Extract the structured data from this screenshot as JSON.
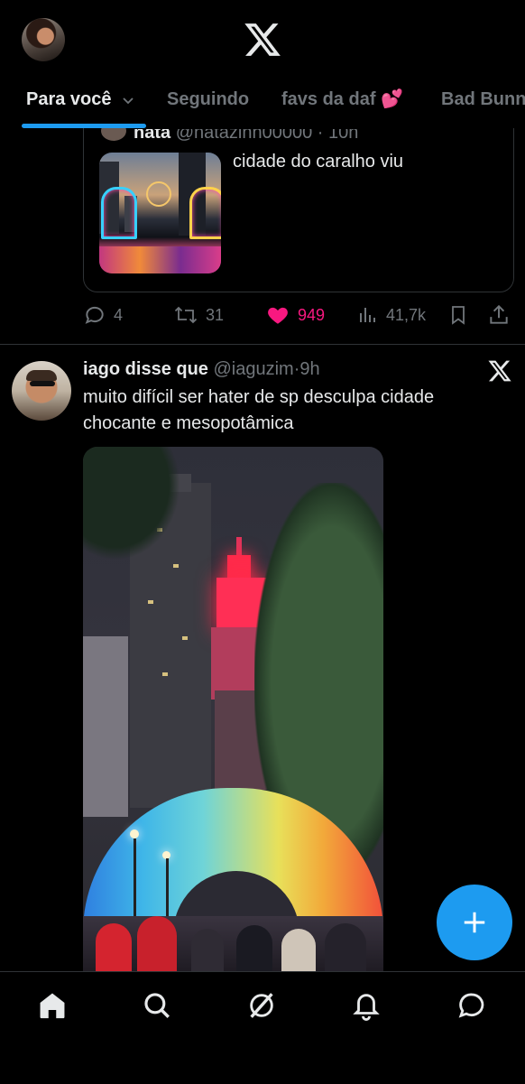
{
  "header": {
    "logo_icon": "x-logo-icon",
    "avatar_icon": "user-avatar"
  },
  "tabs": [
    {
      "label": "Para você",
      "active": true,
      "has_chevron": true
    },
    {
      "label": "Seguindo",
      "active": false
    },
    {
      "label": "favs da daf 💕",
      "active": false
    },
    {
      "label": "Bad Bunn",
      "active": false
    }
  ],
  "tweet1": {
    "quote": {
      "name": "nata",
      "handle": "@natazinh00000",
      "time": "· 10h",
      "text": "cidade do caralho viu"
    },
    "actions": {
      "replies": "4",
      "retweets": "31",
      "likes": "949",
      "views": "41,7k",
      "liked": true
    }
  },
  "tweet2": {
    "name": "iago disse que",
    "handle": "@iaguzim",
    "dot": "·",
    "time": "9h",
    "text": "muito difícil ser hater de sp desculpa cidade chocante e mesopotâmica"
  },
  "colors": {
    "accent": "#1d9bf0",
    "like": "#f91880",
    "muted": "#71767b",
    "text": "#e7e9ea",
    "border": "#2f3336"
  },
  "bottom_nav": [
    "home-icon",
    "search-icon",
    "grok-icon",
    "notifications-icon",
    "messages-icon"
  ]
}
